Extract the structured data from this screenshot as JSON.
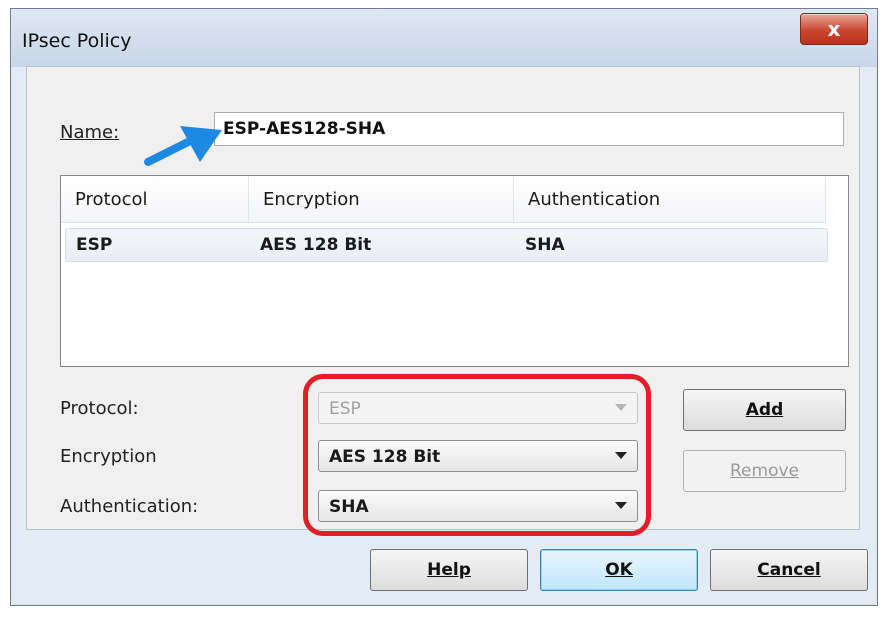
{
  "window": {
    "title": "IPsec Policy",
    "close_glyph": "x"
  },
  "name_field": {
    "label": "Name:",
    "value": "ESP-AES128-SHA"
  },
  "table": {
    "columns": [
      "Protocol",
      "Encryption",
      "Authentication"
    ],
    "rows": [
      {
        "protocol": "ESP",
        "encryption": "AES 128 Bit",
        "authentication": "SHA"
      }
    ]
  },
  "fields": {
    "protocol": {
      "label": "Protocol:",
      "value": "ESP",
      "disabled": true
    },
    "encryption": {
      "label": "Encryption",
      "value": "AES 128 Bit"
    },
    "authentication": {
      "label": "Authentication:",
      "value": "SHA"
    }
  },
  "buttons": {
    "add": "Add",
    "remove": "Remove",
    "help": "Help",
    "ok": "OK",
    "cancel": "Cancel"
  },
  "colors": {
    "highlight": "#e01f26",
    "annotation_arrow": "#1e88e5"
  }
}
